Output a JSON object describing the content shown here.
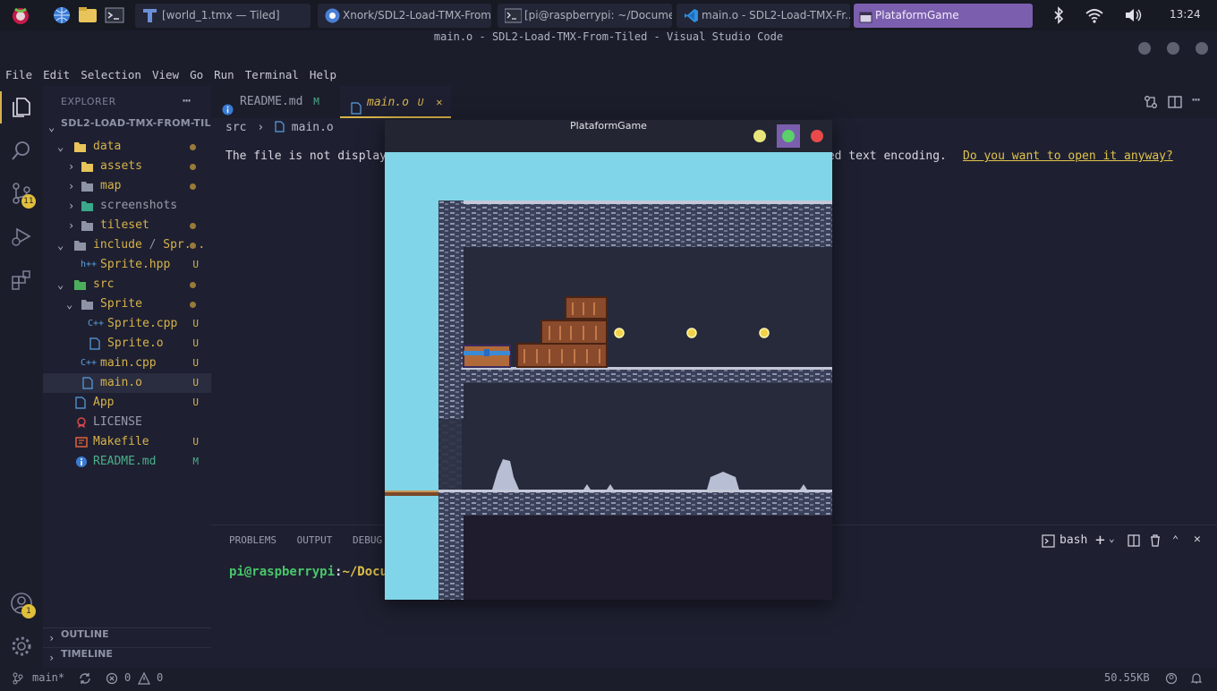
{
  "taskbar": {
    "tasks": [
      {
        "label": "[world_1.tmx — Tiled]"
      },
      {
        "label": "Xnork/SDL2-Load-TMX-From-..."
      },
      {
        "label": "[pi@raspberrypi: ~/Docume..."
      },
      {
        "label": "main.o - SDL2-Load-TMX-Fr..."
      },
      {
        "label": "PlataformGame"
      }
    ],
    "clock": "13:24"
  },
  "window": {
    "title": "main.o - SDL2-Load-TMX-From-Tiled - Visual Studio Code"
  },
  "menu": [
    "File",
    "Edit",
    "Selection",
    "View",
    "Go",
    "Run",
    "Terminal",
    "Help"
  ],
  "activity": {
    "scm_badge": "11",
    "accounts_badge": "1"
  },
  "explorer": {
    "header": "EXPLORER",
    "more": "⋯",
    "root": "SDL2-LOAD-TMX-FROM-TILED",
    "tree": [
      {
        "label": "data"
      },
      {
        "label": "assets"
      },
      {
        "label": "map"
      },
      {
        "label": "screenshots"
      },
      {
        "label": "tileset"
      },
      {
        "label": "include",
        "sep": "/",
        "label2": "Spr..."
      },
      {
        "label": "Sprite.hpp",
        "status": "U"
      },
      {
        "label": "src"
      },
      {
        "label": "Sprite"
      },
      {
        "label": "Sprite.cpp",
        "status": "U"
      },
      {
        "label": "Sprite.o",
        "status": "U"
      },
      {
        "label": "main.cpp",
        "status": "U"
      },
      {
        "label": "main.o",
        "status": "U"
      },
      {
        "label": "App",
        "status": "U"
      },
      {
        "label": "LICENSE"
      },
      {
        "label": "Makefile",
        "status": "U"
      },
      {
        "label": "README.md",
        "status": "M"
      }
    ],
    "outline": "OUTLINE",
    "timeline": "TIMELINE"
  },
  "editor": {
    "tabs": [
      {
        "label": "README.md",
        "status": "M"
      },
      {
        "label": "main.o",
        "status": "U",
        "close": "✕"
      }
    ],
    "breadcrumb": {
      "folder": "src",
      "file": "main.o"
    },
    "message_start": "The file is not display",
    "message_end": "ted text encoding.",
    "message_link": "Do you want to open it anyway?"
  },
  "panel": {
    "tabs": [
      "PROBLEMS",
      "OUTPUT",
      "DEBUG"
    ],
    "shell": "bash",
    "prompt_user": "pi@raspberrypi",
    "prompt_colon": ":",
    "prompt_path": "~/Docum"
  },
  "statusbar": {
    "branch": "main*",
    "errors": "0",
    "warnings": "0",
    "filesize": "50.55KB"
  },
  "game": {
    "title": "PlataformGame"
  },
  "colors": {
    "accent": "#d7b24a",
    "link": "#e0c24a",
    "terminal_green": "#49c66a",
    "task_active": "#7b5fae",
    "sky": "#80d6e8"
  }
}
